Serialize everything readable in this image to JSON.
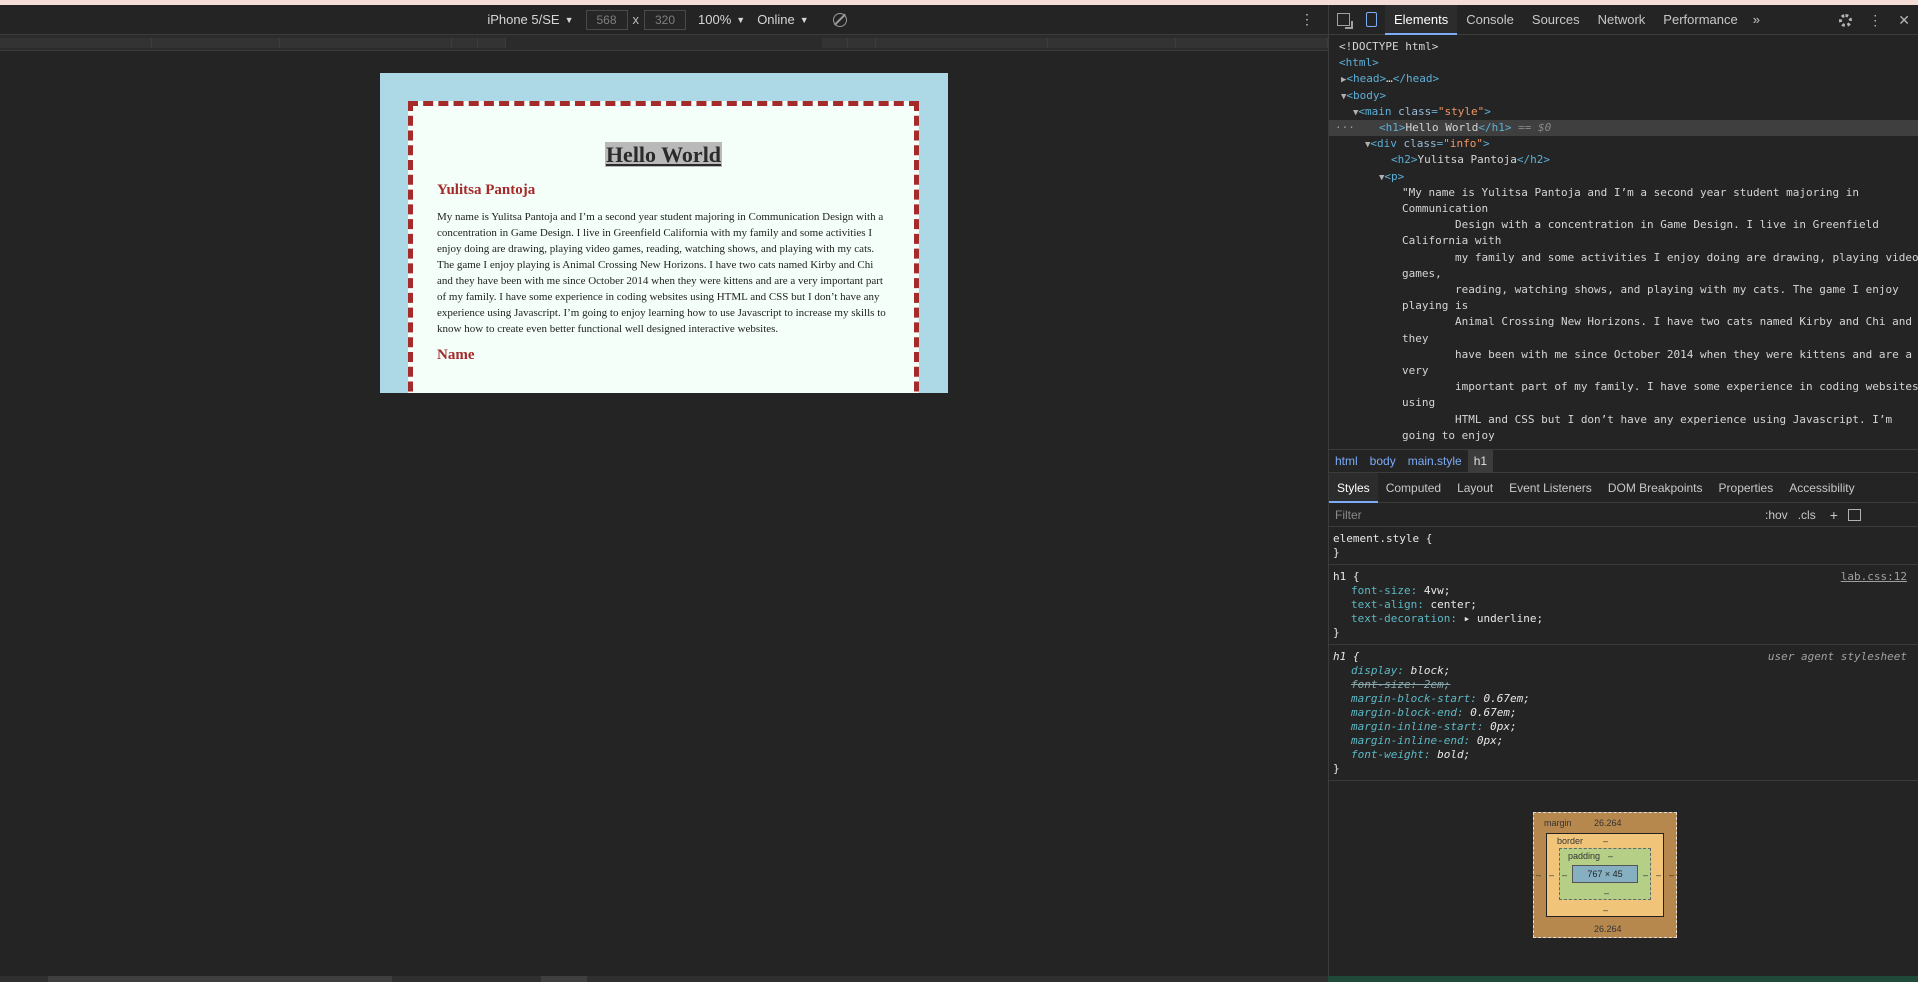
{
  "device_toolbar": {
    "device": "iPhone 5/SE",
    "width": "568",
    "height": "320",
    "zoom": "100%",
    "network": "Online"
  },
  "page": {
    "title": "Hello World",
    "name": "Yulitsa Pantoja",
    "bio": "My name is Yulitsa Pantoja and I’m a second year student majoring in Communication Design with a concentration in Game Design. I live in Greenfield California with my family and some activities I enjoy doing are drawing, playing video games, reading, watching shows, and playing with my cats. The game I enjoy playing is Animal Crossing New Horizons. I have two cats named Kirby and Chi and they have been with me since October 2014 when they were kittens and are a very important part of my family. I have some experience in coding websites using HTML and CSS but I don’t have any experience using Javascript. I’m going to enjoy learning how to use Javascript to increase my skills to know how to create even better functional well designed interactive websites.",
    "next_heading": "Name"
  },
  "devtools": {
    "tabs": [
      "Elements",
      "Console",
      "Sources",
      "Network",
      "Performance"
    ],
    "more": "»",
    "dom": {
      "doctype": "<!DOCTYPE html>",
      "html": "<html>",
      "head_open": "<head>",
      "head_ellipsis": "…",
      "head_close": "</head>",
      "body": "<body>",
      "main_tag": "main",
      "main_attr": "class",
      "main_val": "\"style\"",
      "h1_text": "Hello World",
      "selected_marker": "== $0",
      "div_tag": "div",
      "div_attr": "class",
      "div_val": "\"info\"",
      "h2_text": "Yulitsa Pantoja",
      "p_tag": "<p>",
      "p_text": "\"My name is Yulitsa Pantoja and I’m a second year student majoring in Communication\n        Design with a concentration in Game Design. I live in Greenfield California with\n        my family and some activities I enjoy doing are drawing, playing video games,\n        reading, watching shows, and playing with my cats. The game I enjoy playing is\n        Animal Crossing New Horizons. I have two cats named Kirby and Chi and they\n        have been with me since October 2014 when they were kittens and are a very\n        important part of my family. I have some experience in coding websites using\n        HTML and CSS but I don’t have any experience using Javascript. I’m going to enjoy"
    },
    "breadcrumb": [
      "html",
      "body",
      "main.style",
      "h1"
    ],
    "styles_tabs": [
      "Styles",
      "Computed",
      "Layout",
      "Event Listeners",
      "DOM Breakpoints",
      "Properties",
      "Accessibility"
    ],
    "filter_placeholder": "Filter",
    "hov": ":hov",
    "cls": ".cls",
    "rules": {
      "element_style": "element.style {",
      "close": "}",
      "h1_selector": "h1 {",
      "h1_source": "lab.css:12",
      "h1_props": [
        {
          "name": "font-size",
          "value": "4vw;"
        },
        {
          "name": "text-align",
          "value": "center;"
        },
        {
          "name": "text-decoration",
          "value": "underline;"
        }
      ],
      "ua_selector": "h1 {",
      "ua_source": "user agent stylesheet",
      "ua_props": [
        {
          "name": "display",
          "value": "block;"
        },
        {
          "name": "font-size",
          "value": "2em;"
        },
        {
          "name": "margin-block-start",
          "value": "0.67em;"
        },
        {
          "name": "margin-block-end",
          "value": "0.67em;"
        },
        {
          "name": "margin-inline-start",
          "value": "0px;"
        },
        {
          "name": "margin-inline-end",
          "value": "0px;"
        },
        {
          "name": "font-weight",
          "value": "bold;"
        }
      ]
    },
    "box_model": {
      "margin_label": "margin",
      "margin_top": "26.264",
      "margin_bottom": "26.264",
      "border_label": "border",
      "padding_label": "padding",
      "dash": "–",
      "content": "767 × 45"
    }
  },
  "colors": {
    "page_bg": "#add8e6",
    "border": "#a52a2a",
    "heading": "#a52a2a",
    "accent": "#7cacf8"
  }
}
